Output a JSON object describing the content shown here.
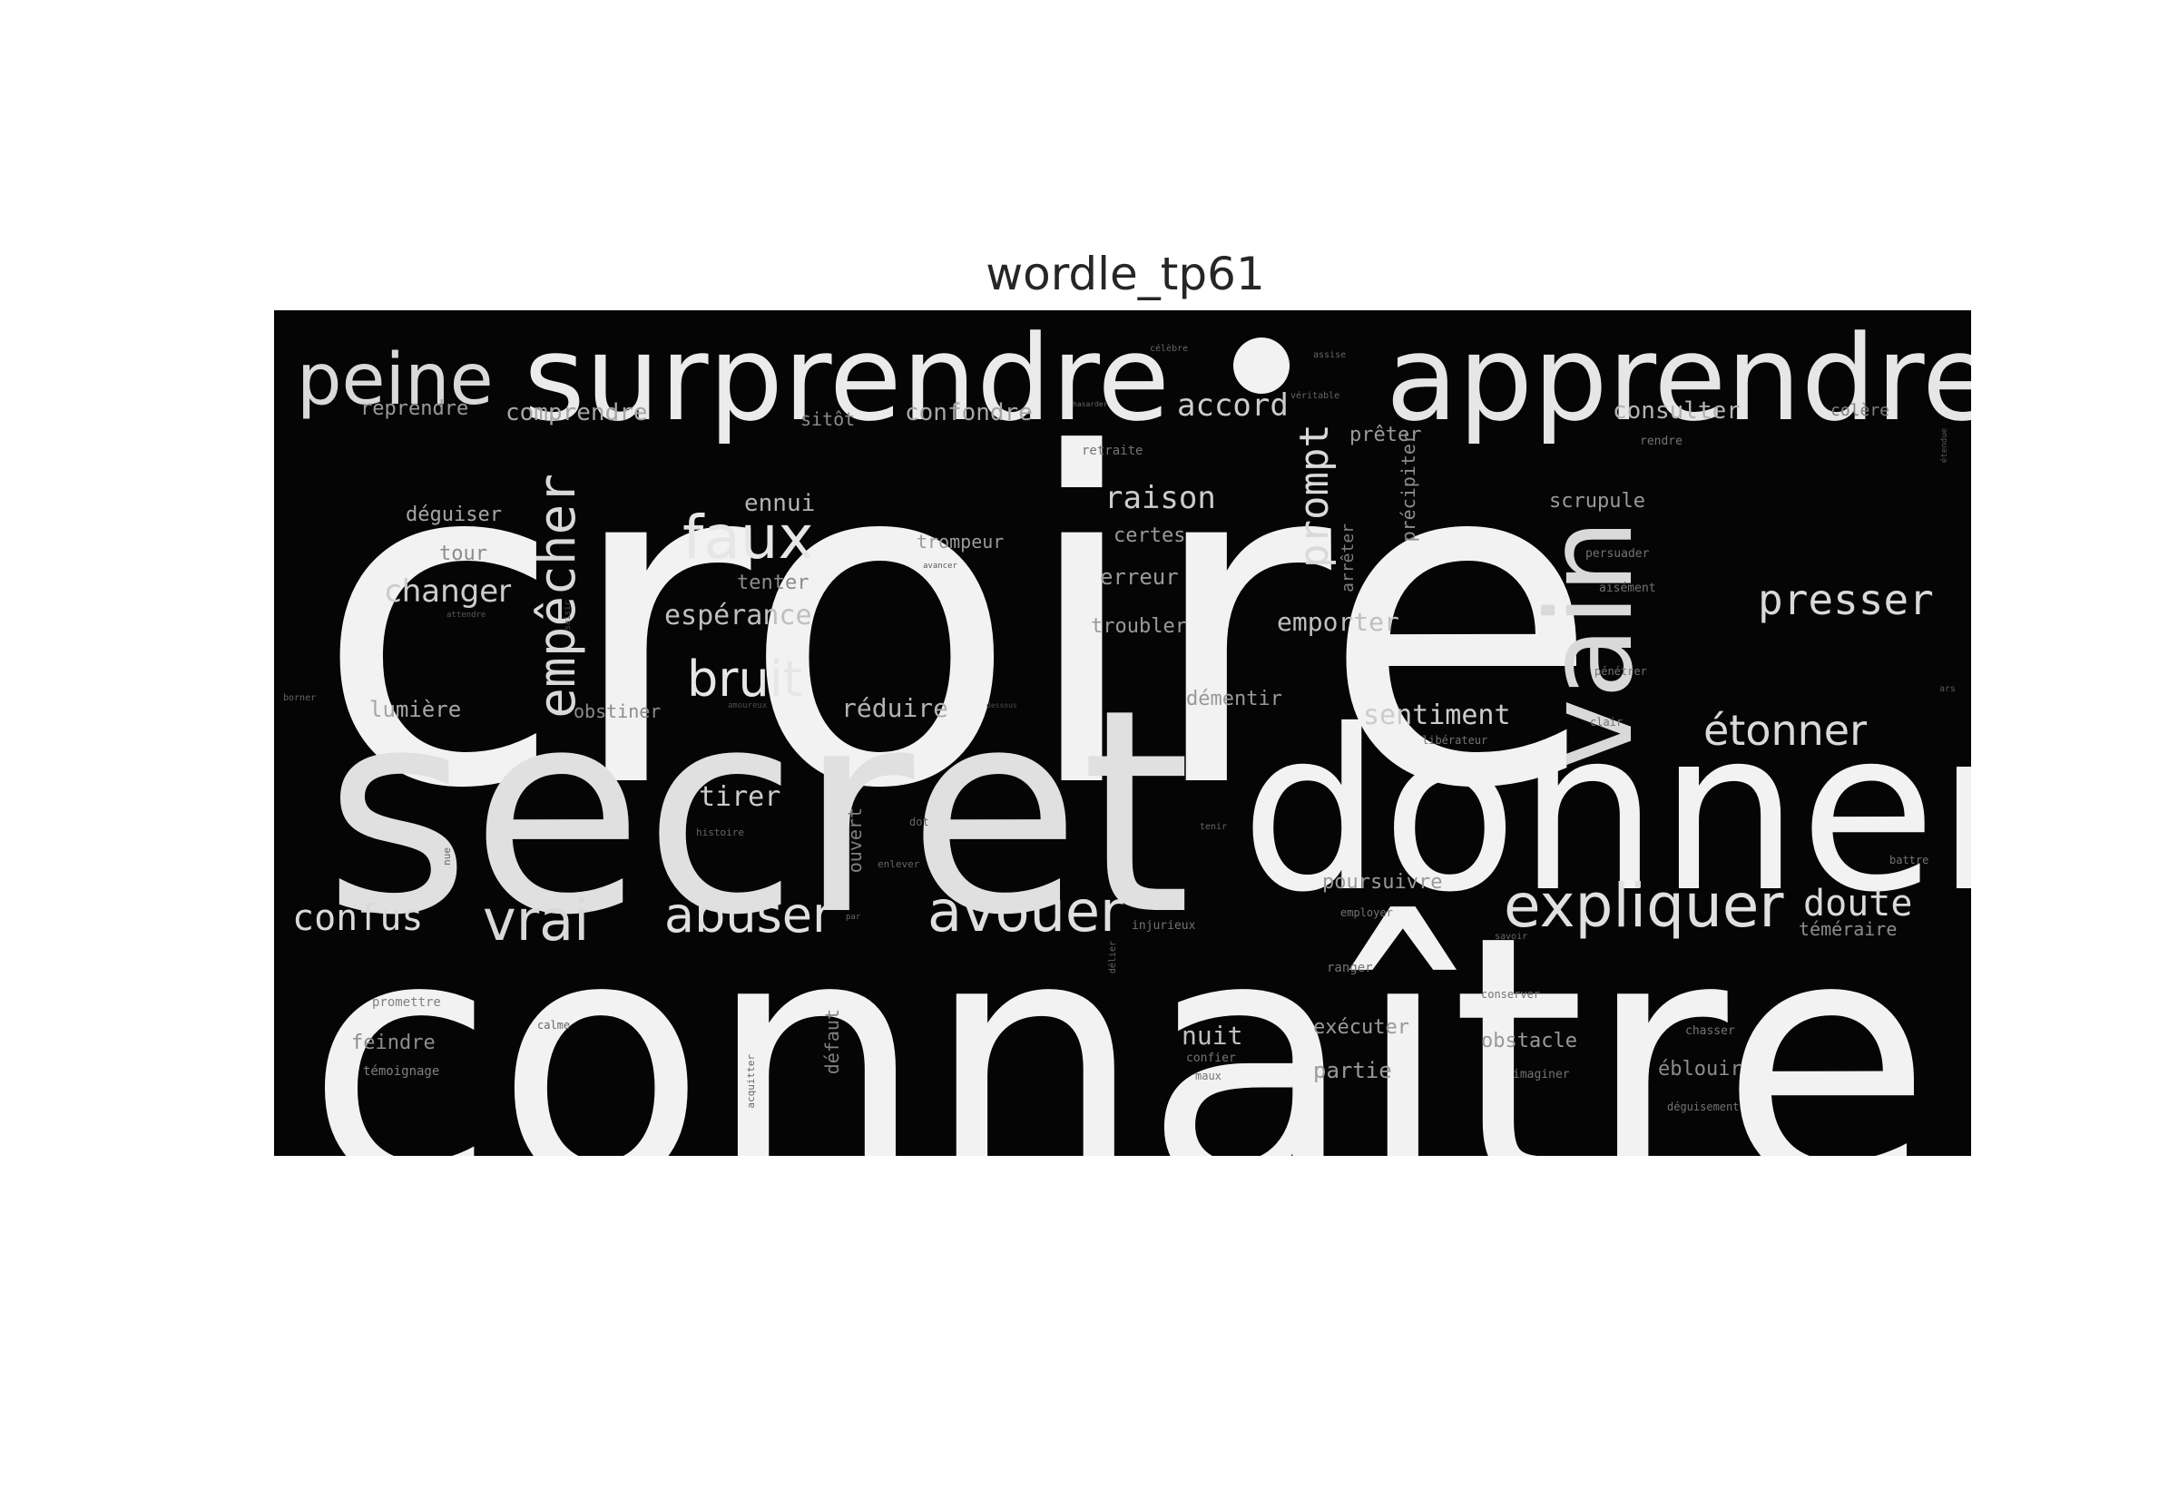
{
  "title": "wordle_tp61",
  "background_color": "#050505",
  "text_color": "#f2f2f2",
  "words": [
    {
      "text": "croire",
      "tone": 0.95
    },
    {
      "text": "connaître",
      "tone": 0.95
    },
    {
      "text": "secret",
      "tone": 0.88
    },
    {
      "text": "donner",
      "tone": 0.95
    },
    {
      "text": "surprendre",
      "tone": 0.92
    },
    {
      "text": "apprendre",
      "tone": 0.9
    },
    {
      "text": "peine",
      "tone": 0.85
    },
    {
      "text": "vain",
      "tone": 0.85
    },
    {
      "text": "faux",
      "tone": 0.9
    },
    {
      "text": "expliquer",
      "tone": 0.88
    },
    {
      "text": "avouer",
      "tone": 0.88
    },
    {
      "text": "abuser",
      "tone": 0.88
    },
    {
      "text": "vrai",
      "tone": 0.85
    },
    {
      "text": "bruit",
      "tone": 0.9
    },
    {
      "text": "empêcher",
      "tone": 0.85
    },
    {
      "text": "prompt",
      "tone": 0.85
    },
    {
      "text": "presser",
      "tone": 0.85
    },
    {
      "text": "étonner",
      "tone": 0.85
    },
    {
      "text": "confus",
      "tone": 0.85
    },
    {
      "text": "doute",
      "tone": 0.85
    },
    {
      "text": "accord",
      "tone": 0.8
    },
    {
      "text": "raison",
      "tone": 0.8
    },
    {
      "text": "changer",
      "tone": 0.8
    },
    {
      "text": "espérance",
      "tone": 0.75
    },
    {
      "text": "sentiment",
      "tone": 0.8
    },
    {
      "text": "tirer",
      "tone": 0.8
    },
    {
      "text": "réduire",
      "tone": 0.7
    },
    {
      "text": "emporter",
      "tone": 0.75
    },
    {
      "text": "consulter",
      "tone": 0.7
    },
    {
      "text": "comprendre",
      "tone": 0.65
    },
    {
      "text": "confondre",
      "tone": 0.65
    },
    {
      "text": "reprendre",
      "tone": 0.6
    },
    {
      "text": "ennui",
      "tone": 0.7
    },
    {
      "text": "nuit",
      "tone": 0.75
    },
    {
      "text": "poursuivre",
      "tone": 0.6
    },
    {
      "text": "lumière",
      "tone": 0.65
    },
    {
      "text": "déguiser",
      "tone": 0.65
    },
    {
      "text": "trompeur",
      "tone": 0.6
    },
    {
      "text": "certes",
      "tone": 0.6
    },
    {
      "text": "erreur",
      "tone": 0.6
    },
    {
      "text": "troubler",
      "tone": 0.6
    },
    {
      "text": "tenter",
      "tone": 0.55
    },
    {
      "text": "tour",
      "tone": 0.55
    },
    {
      "text": "démentir",
      "tone": 0.6
    },
    {
      "text": "prêter",
      "tone": 0.6
    },
    {
      "text": "scrupule",
      "tone": 0.6
    },
    {
      "text": "exécuter",
      "tone": 0.6
    },
    {
      "text": "obstacle",
      "tone": 0.6
    },
    {
      "text": "partie",
      "tone": 0.6
    },
    {
      "text": "feindre",
      "tone": 0.55
    },
    {
      "text": "éblouir",
      "tone": 0.55
    },
    {
      "text": "téméraire",
      "tone": 0.55
    },
    {
      "text": "obstiner",
      "tone": 0.55
    },
    {
      "text": "précipiter",
      "tone": 0.55
    },
    {
      "text": "arrêter",
      "tone": 0.5
    },
    {
      "text": "sitôt",
      "tone": 0.55
    },
    {
      "text": "colère",
      "tone": 0.5
    },
    {
      "text": "ouvert",
      "tone": 0.5
    },
    {
      "text": "défaut",
      "tone": 0.5
    },
    {
      "text": "témoignage",
      "tone": 0.5
    },
    {
      "text": "promettre",
      "tone": 0.5
    },
    {
      "text": "retraite",
      "tone": 0.45
    },
    {
      "text": "rendre",
      "tone": 0.45
    },
    {
      "text": "persuader",
      "tone": 0.45
    },
    {
      "text": "aisément",
      "tone": 0.45
    },
    {
      "text": "pénétrer",
      "tone": 0.45
    },
    {
      "text": "clair",
      "tone": 0.45
    },
    {
      "text": "libérateur",
      "tone": 0.45
    },
    {
      "text": "employer",
      "tone": 0.45
    },
    {
      "text": "injurieux",
      "tone": 0.45
    },
    {
      "text": "ranger",
      "tone": 0.45
    },
    {
      "text": "conserver",
      "tone": 0.45
    },
    {
      "text": "chasser",
      "tone": 0.45
    },
    {
      "text": "imaginer",
      "tone": 0.45
    },
    {
      "text": "déguisement",
      "tone": 0.45
    },
    {
      "text": "battre",
      "tone": 0.45
    },
    {
      "text": "confier",
      "tone": 0.45
    },
    {
      "text": "maux",
      "tone": 0.45
    },
    {
      "text": "hasarder",
      "tone": 0.4
    },
    {
      "text": "véritable",
      "tone": 0.4
    },
    {
      "text": "assise",
      "tone": 0.4
    },
    {
      "text": "célèbre",
      "tone": 0.4
    },
    {
      "text": "avancer",
      "tone": 0.35
    },
    {
      "text": "étendue",
      "tone": 0.35
    },
    {
      "text": "borner",
      "tone": 0.4
    },
    {
      "text": "histoire",
      "tone": 0.4
    },
    {
      "text": "dot",
      "tone": 0.4
    },
    {
      "text": "enlever",
      "tone": 0.4
    },
    {
      "text": "calme",
      "tone": 0.4
    },
    {
      "text": "acquitter",
      "tone": 0.4
    },
    {
      "text": "délier",
      "tone": 0.4
    },
    {
      "text": "nue",
      "tone": 0.4
    },
    {
      "text": "tenir",
      "tone": 0.4
    },
    {
      "text": "savoir",
      "tone": 0.4
    },
    {
      "text": "par",
      "tone": 0.4
    },
    {
      "text": "ars",
      "tone": 0.35
    },
    {
      "text": "attendre",
      "tone": 0.35
    },
    {
      "text": "amoureux",
      "tone": 0.3
    },
    {
      "text": "saisir",
      "tone": 0.3
    },
    {
      "text": "dessous",
      "tone": 0.3
    }
  ]
}
